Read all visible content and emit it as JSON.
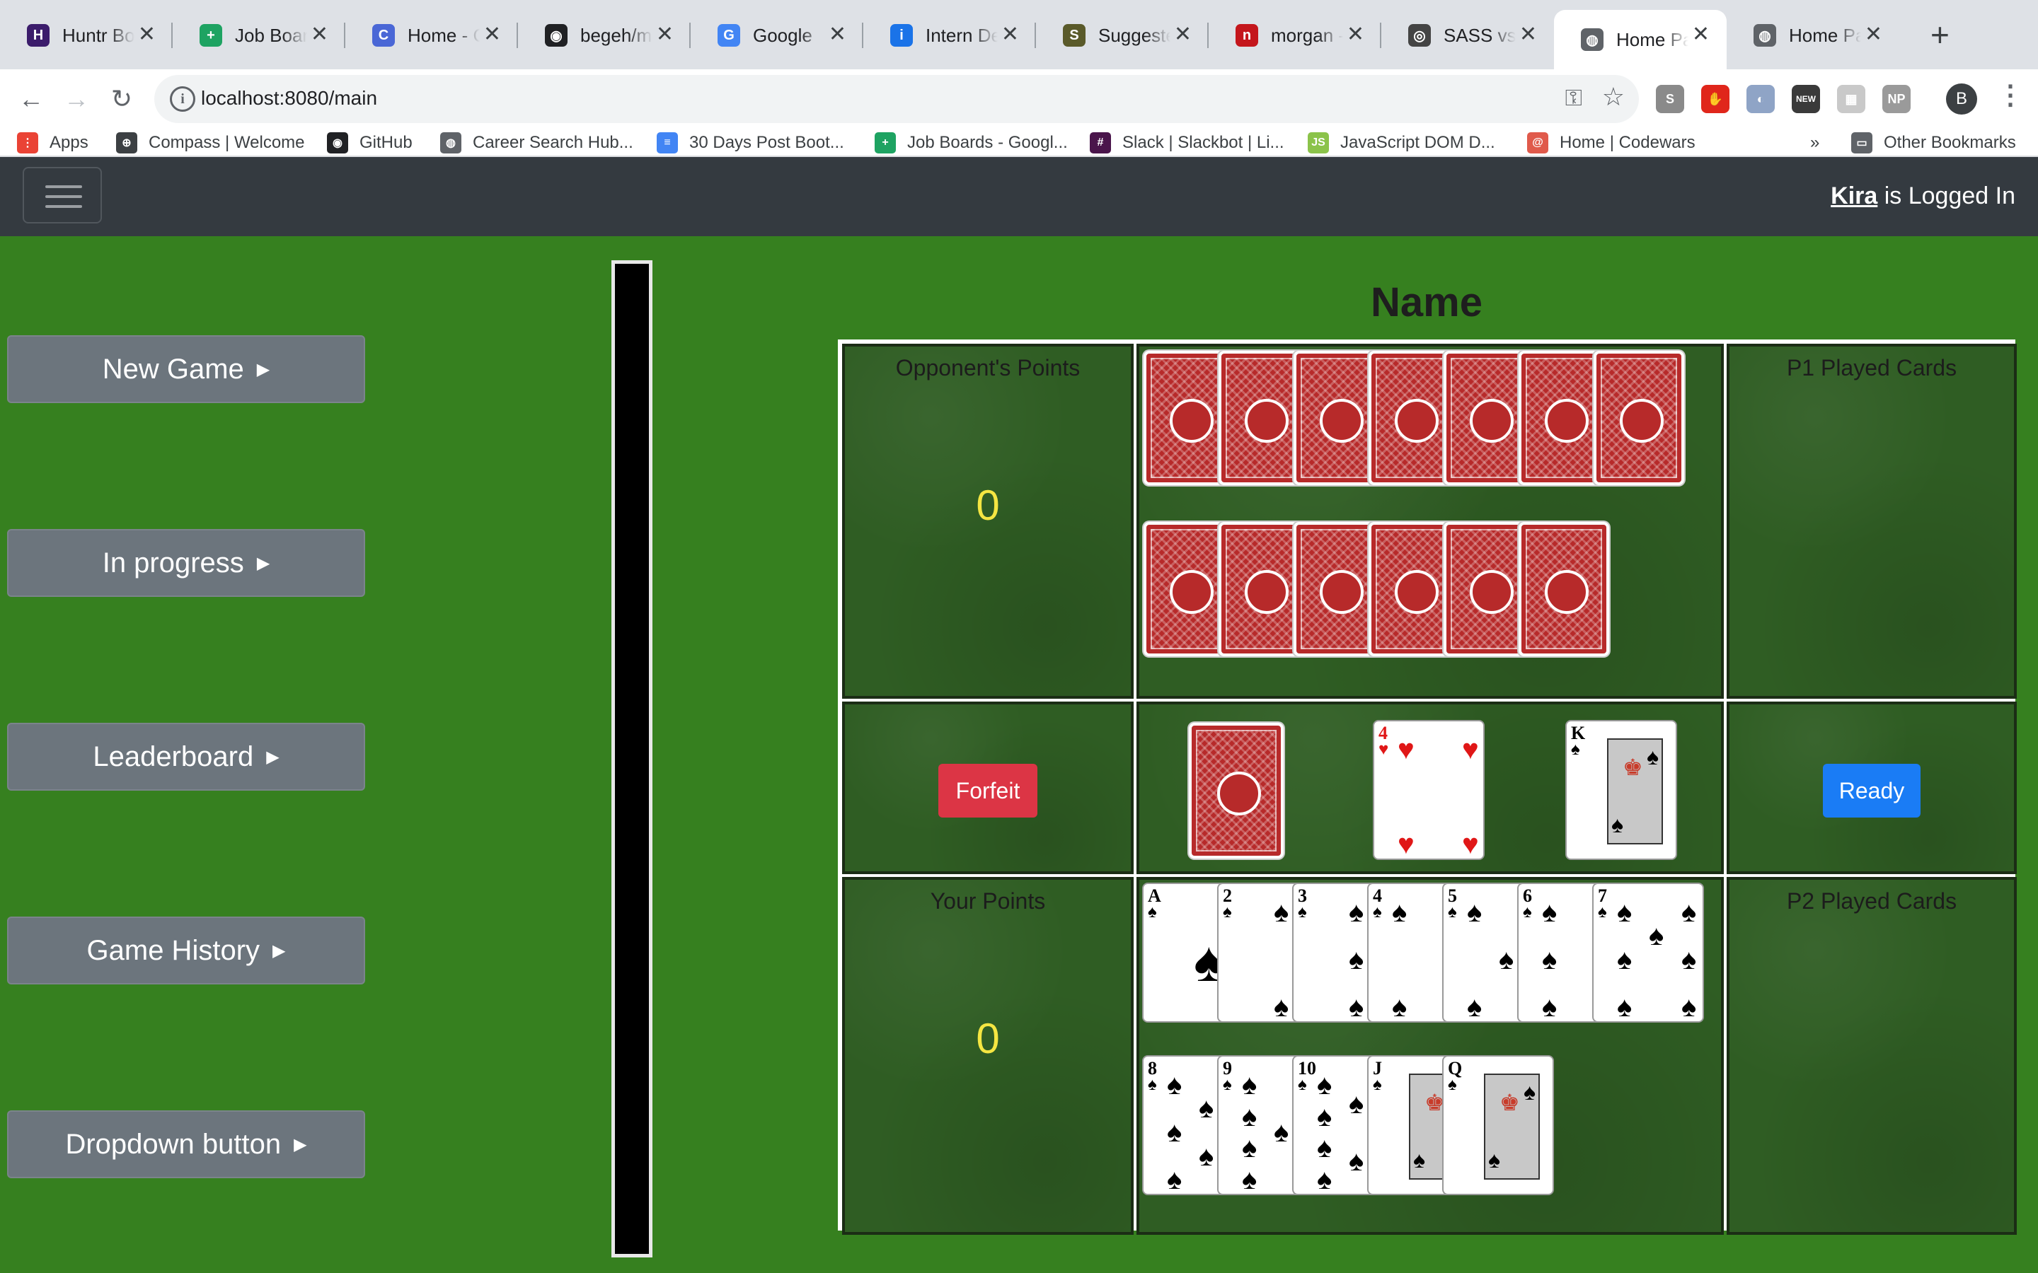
{
  "browser": {
    "tabs": [
      {
        "title": "Huntr Boar",
        "icon": "huntr-icon",
        "color": "#3b1c6b",
        "glyph": "H"
      },
      {
        "title": "Job Boards",
        "icon": "sheets-icon",
        "color": "#1ea362",
        "glyph": "+"
      },
      {
        "title": "Home - Ca",
        "icon": "canvas-icon",
        "color": "#4a67d6",
        "glyph": "C"
      },
      {
        "title": "begeh/mul",
        "icon": "github-icon",
        "color": "#202124",
        "glyph": "◉"
      },
      {
        "title": "Google",
        "icon": "google-icon",
        "color": "#4285f4",
        "glyph": "G"
      },
      {
        "title": "Intern Dev",
        "icon": "intern-icon",
        "color": "#1a73e8",
        "glyph": "i"
      },
      {
        "title": "Suggested",
        "icon": "suggested-icon",
        "color": "#5a5a2a",
        "glyph": "S"
      },
      {
        "title": "morgan - n",
        "icon": "morgan-icon",
        "color": "#c4161c",
        "glyph": "n"
      },
      {
        "title": "SASS vs Sc",
        "icon": "sass-icon",
        "color": "#444444",
        "glyph": "◎"
      },
      {
        "title": "Home Page",
        "icon": "globe-icon",
        "color": "#5f6368",
        "glyph": "◍",
        "active": true
      },
      {
        "title": "Home Page",
        "icon": "globe-icon",
        "color": "#5f6368",
        "glyph": "◍"
      }
    ],
    "url": "localhost:8080/main",
    "bookmarks": [
      {
        "label": "Apps",
        "icon": "apps-grid-icon",
        "color": "#ea4335",
        "glyph": "⋮"
      },
      {
        "label": "Compass | Welcome",
        "icon": "compass-icon",
        "color": "#3c4043",
        "glyph": "⊕"
      },
      {
        "label": "GitHub",
        "icon": "github-icon",
        "color": "#202124",
        "glyph": "◉"
      },
      {
        "label": "Career Search Hub...",
        "icon": "globe-icon",
        "color": "#5f6368",
        "glyph": "◍"
      },
      {
        "label": "30 Days Post Boot...",
        "icon": "docs-icon",
        "color": "#4285f4",
        "glyph": "≡"
      },
      {
        "label": "Job Boards - Googl...",
        "icon": "sheets-icon",
        "color": "#1ea362",
        "glyph": "+"
      },
      {
        "label": "Slack | Slackbot | Li...",
        "icon": "slack-icon",
        "color": "#4a154b",
        "glyph": "#"
      },
      {
        "label": "JavaScript DOM D...",
        "icon": "js-dom-icon",
        "color": "#8bc34a",
        "glyph": "JS"
      },
      {
        "label": "Home | Codewars",
        "icon": "codewars-icon",
        "color": "#e05a4b",
        "glyph": "@"
      }
    ],
    "bookmarks_overflow": "»",
    "other_bookmarks": "Other Bookmarks",
    "profile_initial": "B",
    "extensions": [
      {
        "icon": "skype-icon",
        "color": "#8a8a8a",
        "glyph": "S"
      },
      {
        "icon": "adblock-icon",
        "color": "#e0261b",
        "glyph": "✋"
      },
      {
        "icon": "metamask-icon",
        "color": "#8fa4c6",
        "glyph": "◐"
      },
      {
        "icon": "new-badge-icon",
        "color": "#3a3a3a",
        "glyph": "NEW"
      },
      {
        "icon": "puzzle-icon",
        "color": "#c9c9c9",
        "glyph": "▦"
      },
      {
        "icon": "np-icon",
        "color": "#9a9a9a",
        "glyph": "NP"
      }
    ]
  },
  "navbar": {
    "user": "Kira",
    "status": " is Logged In"
  },
  "sidebar": {
    "buttons": [
      {
        "label": "New Game",
        "name": "new-game-button"
      },
      {
        "label": "In progress",
        "name": "in-progress-button"
      },
      {
        "label": "Leaderboard",
        "name": "leaderboard-button"
      },
      {
        "label": "Game History",
        "name": "game-history-button"
      },
      {
        "label": "Dropdown button",
        "name": "dropdown-button"
      }
    ]
  },
  "board": {
    "title": "Name",
    "opponent_points_label": "Opponent's Points",
    "opponent_points": "0",
    "your_points_label": "Your Points",
    "your_points": "0",
    "p1_played_label": "P1 Played Cards",
    "p2_played_label": "P2 Played Cards",
    "forfeit_label": "Forfeit",
    "ready_label": "Ready",
    "opponent_hand_count": 13,
    "center_cards": [
      {
        "type": "back"
      },
      {
        "rank": "4",
        "suit": "♥",
        "color": "red"
      },
      {
        "rank": "K",
        "suit": "♠",
        "color": "black",
        "face": true
      }
    ],
    "player_hand": [
      {
        "rank": "A",
        "suit": "♠"
      },
      {
        "rank": "2",
        "suit": "♠"
      },
      {
        "rank": "3",
        "suit": "♠"
      },
      {
        "rank": "4",
        "suit": "♠"
      },
      {
        "rank": "5",
        "suit": "♠"
      },
      {
        "rank": "6",
        "suit": "♠"
      },
      {
        "rank": "7",
        "suit": "♠"
      },
      {
        "rank": "8",
        "suit": "♠"
      },
      {
        "rank": "9",
        "suit": "♠"
      },
      {
        "rank": "10",
        "suit": "♠"
      },
      {
        "rank": "J",
        "suit": "♠",
        "face": true
      },
      {
        "rank": "Q",
        "suit": "♠",
        "face": true
      }
    ]
  }
}
